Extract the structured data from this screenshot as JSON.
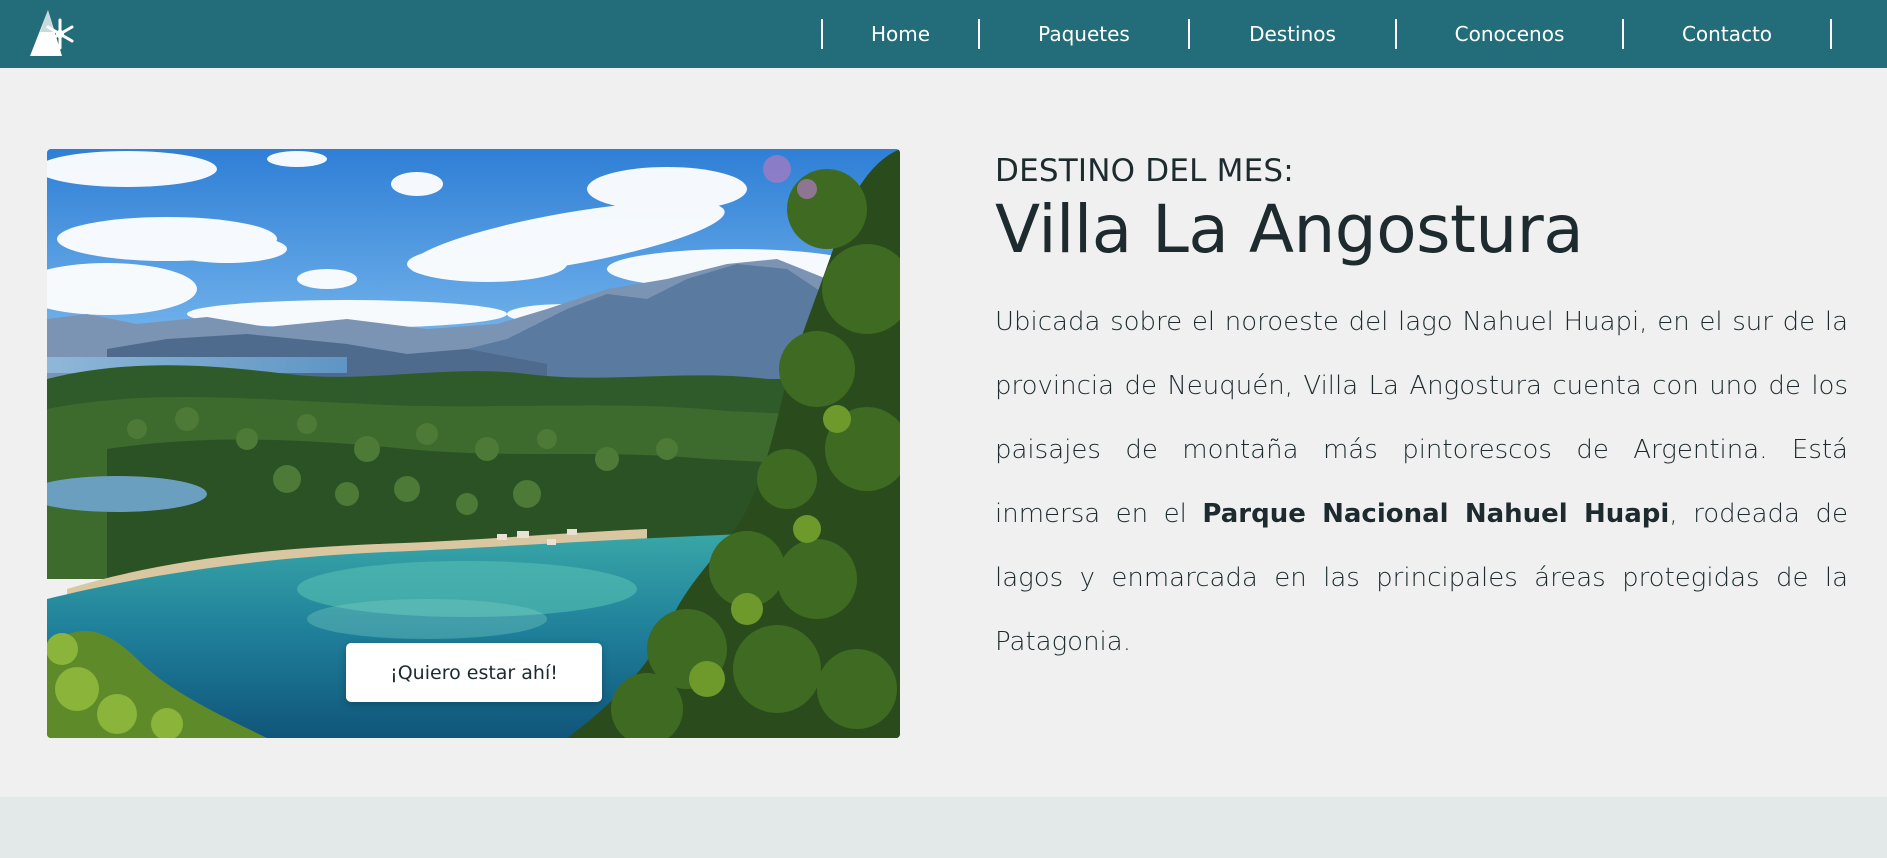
{
  "nav": {
    "logo_icon": "tree-snowflake-icon",
    "items": [
      {
        "label": "Home"
      },
      {
        "label": "Paquetes"
      },
      {
        "label": "Destinos"
      },
      {
        "label": "Conocenos"
      },
      {
        "label": "Contacto"
      }
    ]
  },
  "colors": {
    "nav_background": "#236d7a",
    "page_background": "#f0f0f0",
    "text": "#1d2b2e",
    "bottom_band": "#e3e8e8"
  },
  "hero": {
    "image_description_icon": "lake-mountain-landscape-photo",
    "cta_label": "¡Quiero estar ahí!",
    "eyebrow": "DESTINO DEL MES:",
    "title": "Villa La Angostura",
    "desc_before": "Ubicada sobre el noroeste del lago Nahuel Huapi, en el sur de la provincia de Neuquén, Villa La Angostura cuenta con uno de los paisajes de montaña más pintorescos de Argentina. Está inmersa en el ",
    "desc_bold": "Parque Nacional Nahuel Huapi",
    "desc_after": ", rodeada de lagos y enmarcada en las principales áreas protegidas de la Patagonia."
  }
}
